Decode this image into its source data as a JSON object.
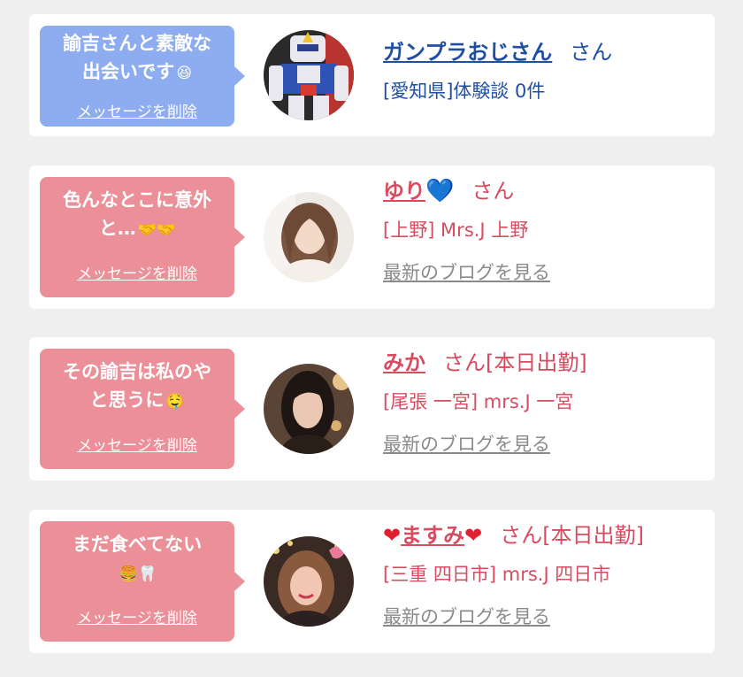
{
  "colors": {
    "bubble_blue": "#8eacf0",
    "bubble_pink": "#eb8f98",
    "name_blue": "#1f4fa3",
    "name_pink": "#d74c60",
    "blog_link": "#8a8a8a"
  },
  "messages": [
    {
      "message": "諭吉さんと素敵な\n出会いです",
      "message_emoji": "😆",
      "delete_label": "メッセージを削除",
      "name_prefix": "",
      "name": "ガンプラおじさん",
      "name_suffix": "",
      "honorific": "さん",
      "status": "",
      "subtitle": "[愛知県]体験談 0件",
      "blog_link": "",
      "avatar_icon": "robot-figure-avatar"
    },
    {
      "message": "色んなとこに意外\nと…",
      "message_emoji": "🤝🤝",
      "delete_label": "メッセージを削除",
      "name_prefix": "",
      "name": "ゆり",
      "name_suffix": "💙",
      "honorific": "さん",
      "status": "",
      "subtitle": "[上野] Mrs.J 上野",
      "blog_link": "最新のブログを見る",
      "avatar_icon": "woman-photo-avatar"
    },
    {
      "message": "その諭吉は私のや\nと思うに",
      "message_emoji": "🤤",
      "delete_label": "メッセージを削除",
      "name_prefix": "",
      "name": "みか",
      "name_suffix": "",
      "honorific": "さん",
      "status": "[本日出勤]",
      "subtitle": "[尾張 一宮] mrs.J 一宮",
      "blog_link": "最新のブログを見る",
      "avatar_icon": "woman-photo-avatar"
    },
    {
      "message": "まだ食べてない\n",
      "message_emoji": "🍔🦷",
      "delete_label": "メッセージを削除",
      "name_prefix": "❤",
      "name": "ますみ",
      "name_suffix": "❤",
      "honorific": "さん",
      "status": "[本日出勤]",
      "subtitle": "[三重 四日市] mrs.J 四日市",
      "blog_link": "最新のブログを見る",
      "avatar_icon": "woman-photo-avatar"
    }
  ]
}
